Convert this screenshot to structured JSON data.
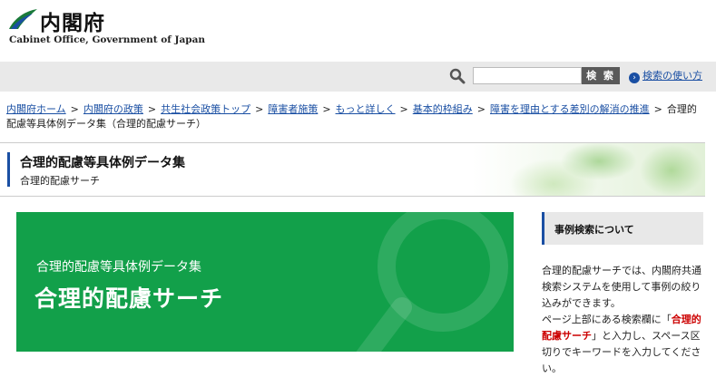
{
  "header": {
    "logo_jp": "内閣府",
    "logo_en": "Cabinet Office, Government of Japan"
  },
  "search": {
    "placeholder": "",
    "button_label": "検 索",
    "howto_label": "検索の使い方"
  },
  "breadcrumbs": {
    "items": [
      "内閣府ホーム",
      "内閣府の政策",
      "共生社会政策トップ",
      "障害者施策",
      "もっと詳しく",
      "基本的枠組み",
      "障害を理由とする差別の解消の推進"
    ],
    "current": "合理的配慮等具体例データ集（合理的配慮サーチ）",
    "separator": ">"
  },
  "page": {
    "title": "合理的配慮等具体例データ集",
    "subtitle": "合理的配慮サーチ"
  },
  "banner": {
    "subtitle": "合理的配慮等具体例データ集",
    "title": "合理的配慮サーチ"
  },
  "sidebar": {
    "heading": "事例検索について",
    "text_1": "合理的配慮サーチでは、内閣府共通検索システムを使用して事例の絞り込みができます。",
    "text_2": "ページ上部にある検索欄に「",
    "text_highlight": "合理的配慮サーチ",
    "text_3": "」と入力し、スペース区切りでキーワードを入力してください。"
  },
  "colors": {
    "brand_blue": "#1a4fa3",
    "banner_green": "#12a04a",
    "highlight_red": "#cc0000"
  }
}
